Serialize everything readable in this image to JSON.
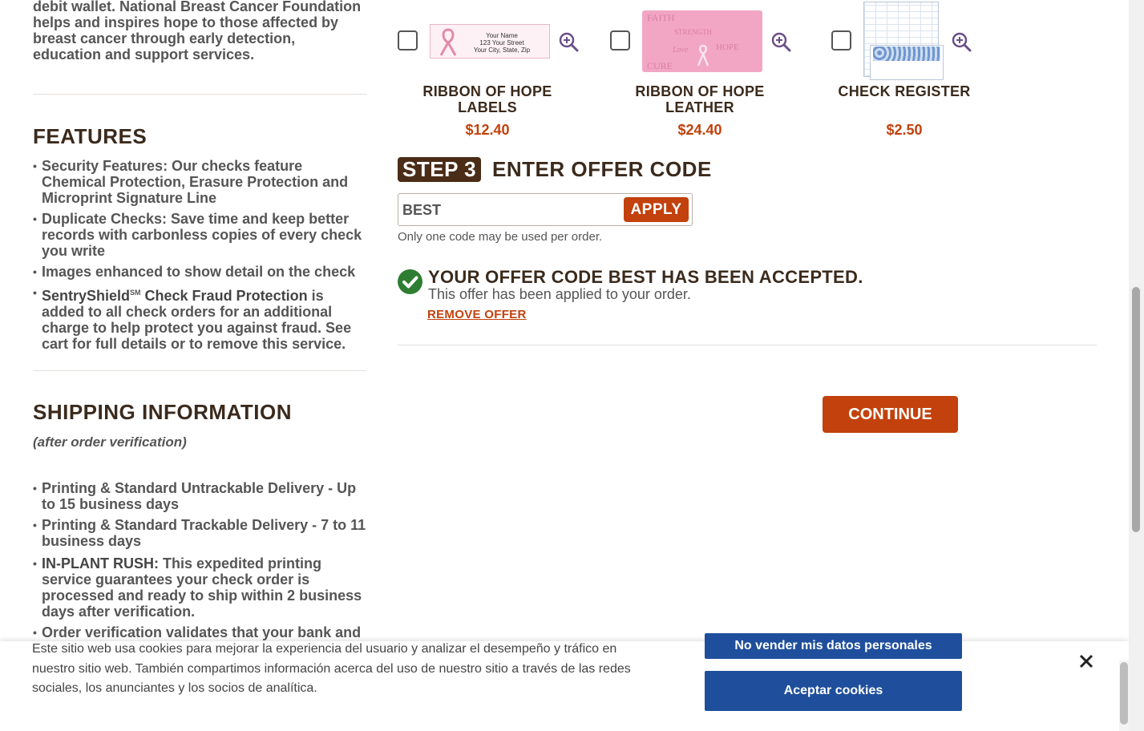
{
  "left": {
    "intro": "debit wallet. National Breast Cancer Foundation helps and inspires hope to those affected by breast cancer through early detection, education and support services.",
    "features": {
      "title": "FEATURES",
      "items": [
        "Security Features: Our checks feature Chemical Protection, Erasure Protection and Microprint Signature Line",
        "Duplicate Checks: Save time and keep better records with carbonless copies of every check you write",
        "Images enhanced to show detail on the check"
      ],
      "sentry": {
        "brand": "SentryShield",
        "sup": "SM",
        "bold": " Check Fraud Protection",
        "rest": " is added to all check orders for an additional charge to help protect you against fraud. See cart for full details or to remove this service."
      }
    },
    "shipping": {
      "title": "SHIPPING INFORMATION",
      "subtitle": "(after order verification)",
      "items": [
        "Printing & Standard Untrackable Delivery - Up to 15 business days",
        "Printing & Standard Trackable Delivery - 7 to 11 business days"
      ],
      "rush": {
        "bold": "IN-PLANT RUSH:",
        "rest": " This expedited printing service guarantees your check order is processed and ready to ship within 2 business days after verification."
      },
      "last": "Order verification validates that your bank and"
    }
  },
  "products": [
    {
      "name": "RIBBON OF HOPE LABELS",
      "price": "$12.40",
      "label_lines": [
        "Your Name",
        "123 Your Street",
        "Your City, State, Zip"
      ]
    },
    {
      "name": "RIBBON OF HOPE LEATHER",
      "price": "$24.40",
      "leather_words": [
        "FAITH",
        "STRENGTH",
        "Love",
        "HOPE",
        "CURE"
      ]
    },
    {
      "name": "CHECK REGISTER",
      "price": "$2.50"
    }
  ],
  "step3": {
    "badge": "STEP 3",
    "title": "ENTER OFFER CODE",
    "code_value": "BEST",
    "apply_label": "APPLY",
    "note": "Only one code may be used per order."
  },
  "offer": {
    "title": "YOUR OFFER CODE BEST HAS BEEN ACCEPTED.",
    "subtitle": "This offer has been applied to your order.",
    "remove_label": "REMOVE OFFER"
  },
  "continue_label": "CONTINUE",
  "cookie": {
    "text": "Este sitio web usa cookies para mejorar la experiencia del usuario y analizar el desempeño y tráfico en nuestro sitio web. También compartimos información acerca del uso de nuestro sitio a través de las redes sociales, los anunciantes y los socios de analítica.",
    "partial_button": "No vender mis datos personales",
    "accept_button": "Aceptar cookies"
  },
  "colors": {
    "accent": "#c2410c",
    "heading": "#3b2a1c",
    "badge": "#4a2c17",
    "success": "#2e7d32",
    "cookie_button": "#1f4f9c"
  },
  "icons": [
    "zoom-in-icon",
    "check-circle-icon",
    "close-icon"
  ]
}
